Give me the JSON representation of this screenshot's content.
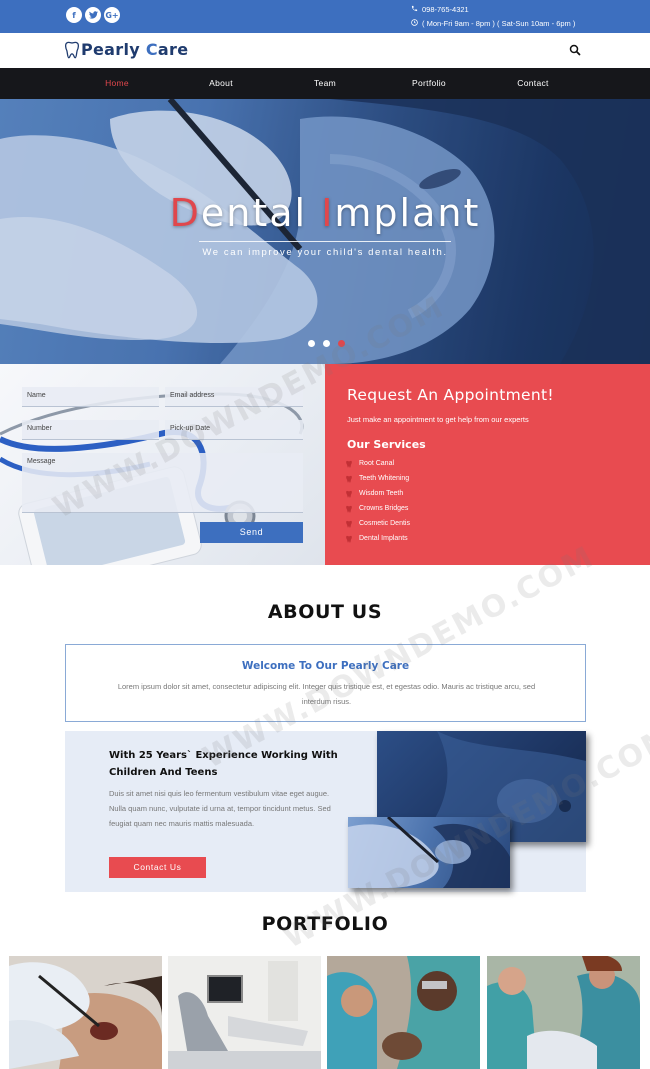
{
  "topbar": {
    "social": [
      {
        "icon": "facebook-icon",
        "glyph": "f"
      },
      {
        "icon": "twitter-icon",
        "glyph": "•"
      },
      {
        "icon": "google-plus-icon",
        "glyph": "G+"
      }
    ],
    "phone": "098-765-4321",
    "hours": "( Mon-Fri 9am - 8pm ) ( Sat-Sun 10am - 6pm )",
    "color": "#3d6fbf"
  },
  "logo": {
    "brand_a": "Pearly",
    "brand_b": "C",
    "brand_c": "are"
  },
  "nav": {
    "items": [
      {
        "label": "Home",
        "active": true
      },
      {
        "label": "About",
        "active": false
      },
      {
        "label": "Team",
        "active": false
      },
      {
        "label": "Portfolio",
        "active": false
      },
      {
        "label": "Contact",
        "active": false
      }
    ],
    "active_color": "#e0474c"
  },
  "hero": {
    "title_first1": "D",
    "title_rest1": "ental",
    "title_first2": "I",
    "title_rest2": "mplant",
    "subtitle": "We can improve your child's dental health.",
    "slides": 3,
    "active_slide": 3
  },
  "appointment_form": {
    "name_placeholder": "Name",
    "email_placeholder": "Email address",
    "number_placeholder": "Number",
    "date_placeholder": "Pick-up Date",
    "message_placeholder": "Message",
    "send_label": "Send"
  },
  "appointment": {
    "title": "Request An Appointment!",
    "subtitle": "Just make an appointment to get help from our experts",
    "services_title": "Our Services",
    "services": [
      "Root Canal",
      "Teeth Whitening",
      "Wisdom Teeth",
      "Crowns Bridges",
      "Cosmetic Dentis",
      "Dental Implants"
    ],
    "color": "#e84b50"
  },
  "about": {
    "title": "ABOUT US",
    "welcome_title": "Welcome To Our Pearly Care",
    "welcome_text": "Lorem ipsum dolor sit amet, consectetur adipiscing elit. Integer quis tristique est, et egestas odio. Mauris ac tristique arcu, sed interdum risus.",
    "exp_title": "With 25 Years` Experience Working With Children And Teens",
    "exp_text": "Duis sit amet nisi quis leo fermentum vestibulum vitae eget augue. Nulla quam nunc, vulputate id urna at, tempor tincidunt metus. Sed feugiat quam nec mauris mattis malesuada.",
    "contact_label": "Contact Us"
  },
  "portfolio": {
    "title": "PORTFOLIO"
  },
  "watermark": [
    "WWW.DOWNDEMO.COM",
    "WWW.DOWNDEMO.COM",
    "WWW.DOWNDEMO.COM"
  ]
}
